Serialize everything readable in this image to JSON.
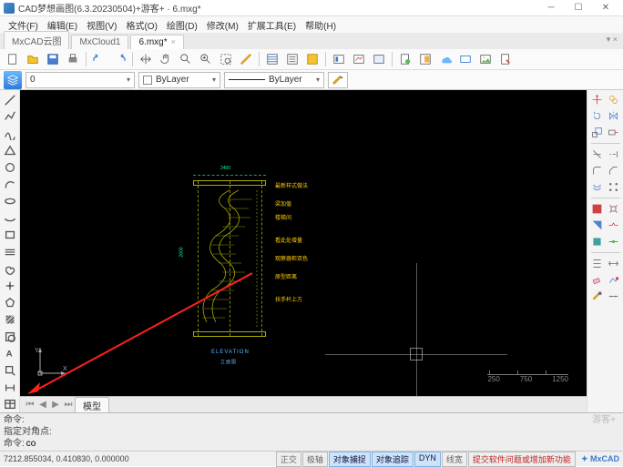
{
  "window": {
    "title": "CAD梦想画图(6.3.20230504)+游客+ · 6.mxg*"
  },
  "menu": [
    "文件(F)",
    "编辑(E)",
    "视图(V)",
    "格式(O)",
    "绘图(D)",
    "修改(M)",
    "扩展工具(E)",
    "帮助(H)"
  ],
  "tabs": {
    "items": [
      "MxCAD云图",
      "MxCloud1",
      "6.mxg*"
    ],
    "active": 2
  },
  "props": {
    "layer_selector": "0",
    "color_selector": "ByLayer",
    "linetype_selector": "ByLayer"
  },
  "viewtabs": {
    "items": [
      "模型"
    ]
  },
  "drawing": {
    "annotations": [
      "最新样式做法",
      "梁加值",
      "楼梯间",
      "看此处增量",
      "观察器柜双色",
      "原型距离",
      "扶手杆上方"
    ],
    "title": "ELEVATION",
    "subtitle": "立面图",
    "dim_top": "2400",
    "dim_side": "2600"
  },
  "ucs": {
    "x": "X",
    "y": "Y"
  },
  "scale": {
    "a": "250",
    "b": "750",
    "c": "1250"
  },
  "command": {
    "history1": "命令:",
    "history2": "指定对角点:",
    "prompt": "命令:",
    "input": "co",
    "ghost": "游客+"
  },
  "status": {
    "coords": "7212.855034, 0.410830, 0.000000",
    "toggles": [
      {
        "label": "正交",
        "on": false
      },
      {
        "label": "极轴",
        "on": false
      },
      {
        "label": "对象捕捉",
        "on": true
      },
      {
        "label": "对象追踪",
        "on": true
      },
      {
        "label": "DYN",
        "on": true
      },
      {
        "label": "线宽",
        "on": false
      }
    ],
    "alert": "提交软件问题或增加新功能",
    "logo": "MxCAD"
  }
}
